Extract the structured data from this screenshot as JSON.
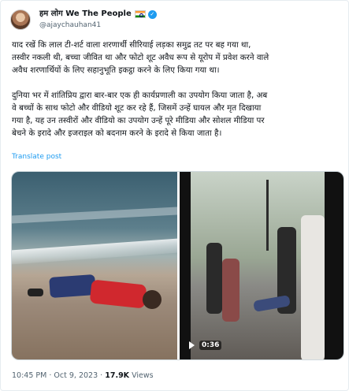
{
  "author": {
    "display_name": "हम लोग We The People",
    "handle": "@ajaychauhan41",
    "avatar_icon": "avatar",
    "flag_icon": "india-flag-icon",
    "verified_icon": "verified-badge-icon"
  },
  "tweet": {
    "paragraph_1": "याद रखें कि लाल टी-शर्ट वाला शरणार्थी सीरियाई लड़का समुद्र तट पर बह गया था,\nतस्वीर नकली थी, बच्चा जीवित था और फोटो शूट अवैध रूप से यूरोप में प्रवेश करने वाले\nअवैध शरणार्थियों के लिए सहानुभूति इकट्ठा करने के लिए किया गया था।",
    "paragraph_2": "दुनिया भर में शांतिप्रिय द्वारा बार-बार एक ही कार्यप्रणाली का उपयोग किया जाता है, अब\nवे बच्चों के साथ फोटो और वीडियो शूट कर रहे हैं, जिसमें उन्हें घायल और मृत दिखाया\nगया है, यह उन तस्वीरों और वीडियो का उपयोग उन्हें पूरे मीडिया और सोशल मीडिया पर\nबेचने के इरादे और इजराइल को बदनाम करने के इरादे से किया जाता है।",
    "translate_label": "Translate post"
  },
  "media": {
    "video_duration": "0:36",
    "play_icon": "play-icon"
  },
  "meta": {
    "time": "10:45 PM",
    "separator": "·",
    "date": "Oct 9, 2023",
    "views_count": "17.9K",
    "views_label": "Views"
  }
}
